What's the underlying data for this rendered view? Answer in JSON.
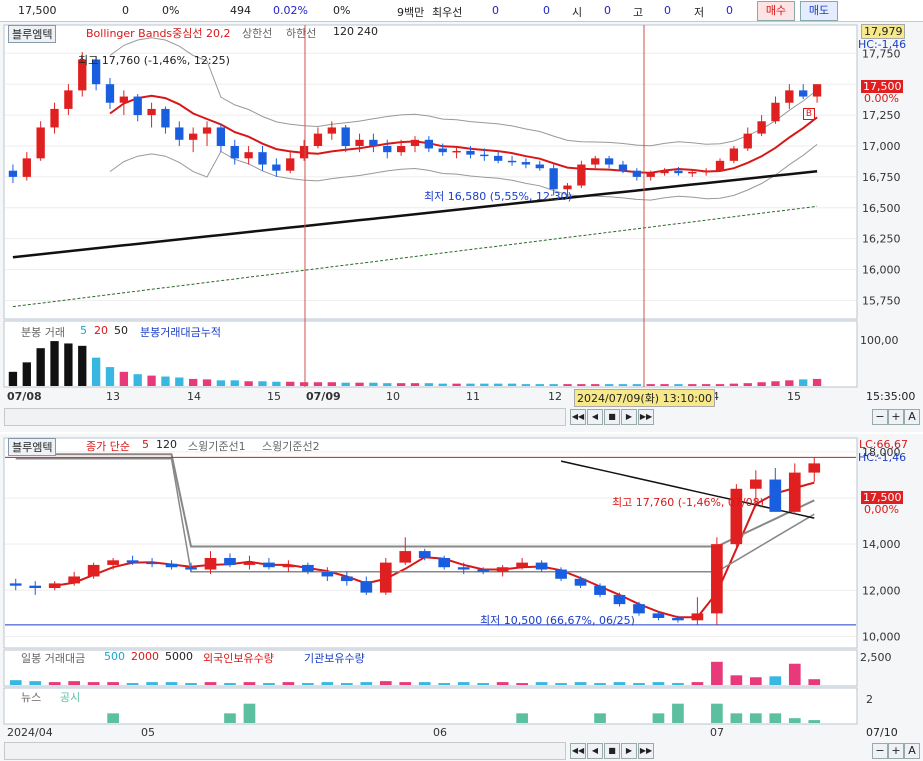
{
  "topbar": {
    "price": "17,500",
    "change": "0",
    "change_pct": "0%",
    "volume": "494",
    "pct2": "0.02%",
    "pct3": "0%",
    "vol_label": "9백만",
    "bid_label": "최우선",
    "v1": "0",
    "v2": "0",
    "open_label": "시",
    "open_val": "0",
    "high_label": "고",
    "high_val": "0",
    "low_label": "저",
    "low_val": "0",
    "buy_btn": "매수",
    "sell_btn": "매도"
  },
  "top_chart": {
    "tab": "블루엠텍",
    "legend_bb": "Bollinger Bands중심선 20,2",
    "legend_upper": "상한선",
    "legend_lower": "하한선",
    "legend_120": "120",
    "legend_240": "240",
    "max_label": "최고 17,760 (-1,46%, 12:25)",
    "min_label": "최저 16,580 (5,55%, 12:30)",
    "axis_top": "17,979",
    "hc": "HC:-1,46",
    "last_price": "17,500",
    "last_pct": "0.00%",
    "b_marker": "B",
    "vol_tab": "분봉 거래",
    "vol_5": "5",
    "vol_20": "20",
    "vol_50": "50",
    "vol_cum": "분봉거래대금누적",
    "vol_axis": "100,00",
    "crosshair": "2024/07/09(화) 13:10:00",
    "time_right": "15:35:00",
    "x_labels": [
      "07/08",
      "13",
      "14",
      "15",
      "07/09",
      "10",
      "11",
      "12",
      "4",
      "15"
    ]
  },
  "bottom_chart": {
    "tab": "블루엠텍",
    "legend_close": "종가 단순",
    "legend_5": "5",
    "legend_120": "120",
    "legend_sw1": "스윙기준선1",
    "legend_sw2": "스윙기준선2",
    "lc": "LC:66,67",
    "hc": "HC:-1,46",
    "max_label": "최고 17,760 (-1,46%, 07/08)",
    "min_label": "최저 10,500 (66,67%, 06/25)",
    "last_price": "17,500",
    "last_pct": "0,00%",
    "vol_tab": "일봉 거래대금",
    "vol_500": "500",
    "vol_2000": "2000",
    "vol_5000": "5000",
    "vol_foreign": "외국인보유수량",
    "vol_inst": "기관보유수량",
    "vol_axis": "2,500",
    "news_tab": "뉴스",
    "disclosure_tab": "공시",
    "news_axis": "2",
    "date_right": "07/10",
    "x_labels": [
      "2024/04",
      "05",
      "06",
      "07"
    ]
  },
  "chart_data": [
    {
      "type": "candlestick",
      "interval": "minute",
      "ylim": [
        15600,
        17979
      ],
      "yticks": [
        15750,
        16000,
        16250,
        16500,
        16750,
        17000,
        17250,
        17500,
        17750
      ],
      "high": 17760,
      "low": 16580,
      "last": 17500,
      "candles": [
        [
          16800,
          16850,
          16700,
          16750
        ],
        [
          16750,
          16950,
          16720,
          16900
        ],
        [
          16900,
          17200,
          16880,
          17150
        ],
        [
          17150,
          17350,
          17100,
          17300
        ],
        [
          17300,
          17500,
          17250,
          17450
        ],
        [
          17450,
          17760,
          17400,
          17700
        ],
        [
          17700,
          17720,
          17450,
          17500
        ],
        [
          17500,
          17550,
          17300,
          17350
        ],
        [
          17350,
          17450,
          17250,
          17400
        ],
        [
          17400,
          17420,
          17200,
          17250
        ],
        [
          17250,
          17350,
          17150,
          17300
        ],
        [
          17300,
          17320,
          17100,
          17150
        ],
        [
          17150,
          17200,
          17000,
          17050
        ],
        [
          17050,
          17150,
          16950,
          17100
        ],
        [
          17100,
          17200,
          17000,
          17150
        ],
        [
          17150,
          17180,
          16950,
          17000
        ],
        [
          17000,
          17050,
          16850,
          16900
        ],
        [
          16900,
          17000,
          16850,
          16950
        ],
        [
          16950,
          17000,
          16800,
          16850
        ],
        [
          16850,
          16900,
          16750,
          16800
        ],
        [
          16800,
          16950,
          16780,
          16900
        ],
        [
          16900,
          17050,
          16880,
          17000
        ],
        [
          17000,
          17150,
          16980,
          17100
        ],
        [
          17100,
          17200,
          17050,
          17150
        ],
        [
          17150,
          17170,
          16950,
          17000
        ],
        [
          17000,
          17100,
          16950,
          17050
        ],
        [
          17050,
          17100,
          16950,
          17000
        ],
        [
          17000,
          17050,
          16900,
          16950
        ],
        [
          16950,
          17050,
          16920,
          17000
        ],
        [
          17000,
          17080,
          16950,
          17050
        ],
        [
          17050,
          17080,
          16950,
          16980
        ],
        [
          16980,
          17020,
          16920,
          16950
        ],
        [
          16950,
          17000,
          16900,
          16960
        ],
        [
          16960,
          17000,
          16900,
          16930
        ],
        [
          16930,
          16980,
          16880,
          16920
        ],
        [
          16920,
          16960,
          16860,
          16880
        ],
        [
          16880,
          16920,
          16840,
          16870
        ],
        [
          16870,
          16900,
          16820,
          16850
        ],
        [
          16850,
          16880,
          16800,
          16820
        ],
        [
          16820,
          16850,
          16600,
          16650
        ],
        [
          16650,
          16700,
          16580,
          16680
        ],
        [
          16680,
          16880,
          16660,
          16850
        ],
        [
          16850,
          16920,
          16820,
          16900
        ],
        [
          16900,
          16920,
          16820,
          16850
        ],
        [
          16850,
          16880,
          16780,
          16800
        ],
        [
          16800,
          16820,
          16720,
          16750
        ],
        [
          16750,
          16800,
          16720,
          16780
        ],
        [
          16780,
          16820,
          16760,
          16800
        ],
        [
          16800,
          16830,
          16760,
          16780
        ],
        [
          16780,
          16810,
          16750,
          16790
        ],
        [
          16790,
          16820,
          16760,
          16800
        ],
        [
          16800,
          16900,
          16790,
          16880
        ],
        [
          16880,
          17000,
          16860,
          16980
        ],
        [
          16980,
          17150,
          16960,
          17100
        ],
        [
          17100,
          17250,
          17080,
          17200
        ],
        [
          17200,
          17400,
          17180,
          17350
        ],
        [
          17350,
          17500,
          17300,
          17450
        ],
        [
          17450,
          17500,
          17380,
          17400
        ],
        [
          17400,
          17500,
          17350,
          17500
        ]
      ],
      "volume": [
        30,
        50,
        80,
        95,
        90,
        85,
        60,
        40,
        30,
        25,
        22,
        20,
        18,
        15,
        14,
        12,
        12,
        10,
        10,
        9,
        9,
        8,
        8,
        8,
        7,
        7,
        7,
        6,
        6,
        6,
        6,
        5,
        5,
        5,
        5,
        5,
        5,
        4,
        4,
        4,
        4,
        4,
        4,
        4,
        4,
        4,
        4,
        4,
        4,
        4,
        4,
        4,
        5,
        6,
        8,
        10,
        12,
        14,
        15
      ],
      "vol_ylim": [
        0,
        110
      ]
    },
    {
      "type": "candlestick",
      "interval": "day",
      "ylim": [
        9500,
        18600
      ],
      "yticks": [
        10000,
        12000,
        14000,
        16000,
        18000
      ],
      "high": 17760,
      "low": 10500,
      "last": 17500,
      "candles": [
        [
          12300,
          12500,
          12000,
          12200
        ],
        [
          12200,
          12400,
          11800,
          12100
        ],
        [
          12100,
          12400,
          12000,
          12300
        ],
        [
          12300,
          12800,
          12200,
          12600
        ],
        [
          12600,
          13200,
          12500,
          13100
        ],
        [
          13100,
          13400,
          12900,
          13300
        ],
        [
          13300,
          13500,
          13100,
          13200
        ],
        [
          13200,
          13400,
          13000,
          13150
        ],
        [
          13150,
          13300,
          12900,
          13000
        ],
        [
          13000,
          13200,
          12800,
          12900
        ],
        [
          12900,
          13700,
          12700,
          13400
        ],
        [
          13400,
          13600,
          13000,
          13100
        ],
        [
          13100,
          13500,
          12900,
          13200
        ],
        [
          13200,
          13400,
          12900,
          13000
        ],
        [
          13000,
          13300,
          12800,
          13100
        ],
        [
          13100,
          13200,
          12700,
          12800
        ],
        [
          12800,
          13000,
          12400,
          12600
        ],
        [
          12600,
          12800,
          12200,
          12400
        ],
        [
          12400,
          12600,
          11800,
          11900
        ],
        [
          11900,
          13400,
          11800,
          13200
        ],
        [
          13200,
          14300,
          13100,
          13700
        ],
        [
          13700,
          13800,
          13300,
          13400
        ],
        [
          13400,
          13500,
          12900,
          13000
        ],
        [
          13000,
          13200,
          12700,
          12900
        ],
        [
          12900,
          13000,
          12700,
          12800
        ],
        [
          12800,
          13100,
          12600,
          13000
        ],
        [
          13000,
          13400,
          12900,
          13200
        ],
        [
          13200,
          13300,
          12800,
          12900
        ],
        [
          12900,
          13000,
          12400,
          12500
        ],
        [
          12500,
          12600,
          12100,
          12200
        ],
        [
          12200,
          12300,
          11700,
          11800
        ],
        [
          11800,
          11900,
          11300,
          11400
        ],
        [
          11400,
          11500,
          10900,
          11000
        ],
        [
          11000,
          11100,
          10700,
          10800
        ],
        [
          10800,
          10900,
          10600,
          10700
        ],
        [
          10700,
          11700,
          10500,
          11000
        ],
        [
          11000,
          14300,
          10500,
          14000
        ],
        [
          14000,
          16600,
          13900,
          16400
        ],
        [
          16400,
          17200,
          15600,
          16800
        ],
        [
          16800,
          17300,
          16200,
          15400
        ],
        [
          15400,
          17500,
          15300,
          17100
        ],
        [
          17100,
          17760,
          16700,
          17500
        ]
      ],
      "volume": [
        5,
        4,
        3,
        4,
        3,
        3,
        2,
        3,
        3,
        2,
        3,
        2,
        3,
        2,
        3,
        2,
        3,
        2,
        3,
        4,
        3,
        3,
        2,
        3,
        2,
        3,
        2,
        3,
        2,
        3,
        2,
        3,
        2,
        3,
        2,
        3,
        24,
        10,
        8,
        9,
        22,
        6
      ],
      "vol_ylim": [
        0,
        30
      ],
      "news": [
        0,
        0,
        0,
        0,
        0,
        1,
        0,
        0,
        0,
        0,
        0,
        1,
        2,
        0,
        0,
        0,
        0,
        0,
        0,
        0,
        0,
        0,
        0,
        0,
        0,
        0,
        1,
        0,
        0,
        0,
        1,
        0,
        0,
        1,
        2,
        0,
        2,
        1,
        1,
        1,
        0.5,
        0.3
      ],
      "news_ylim": [
        0,
        3
      ]
    }
  ]
}
